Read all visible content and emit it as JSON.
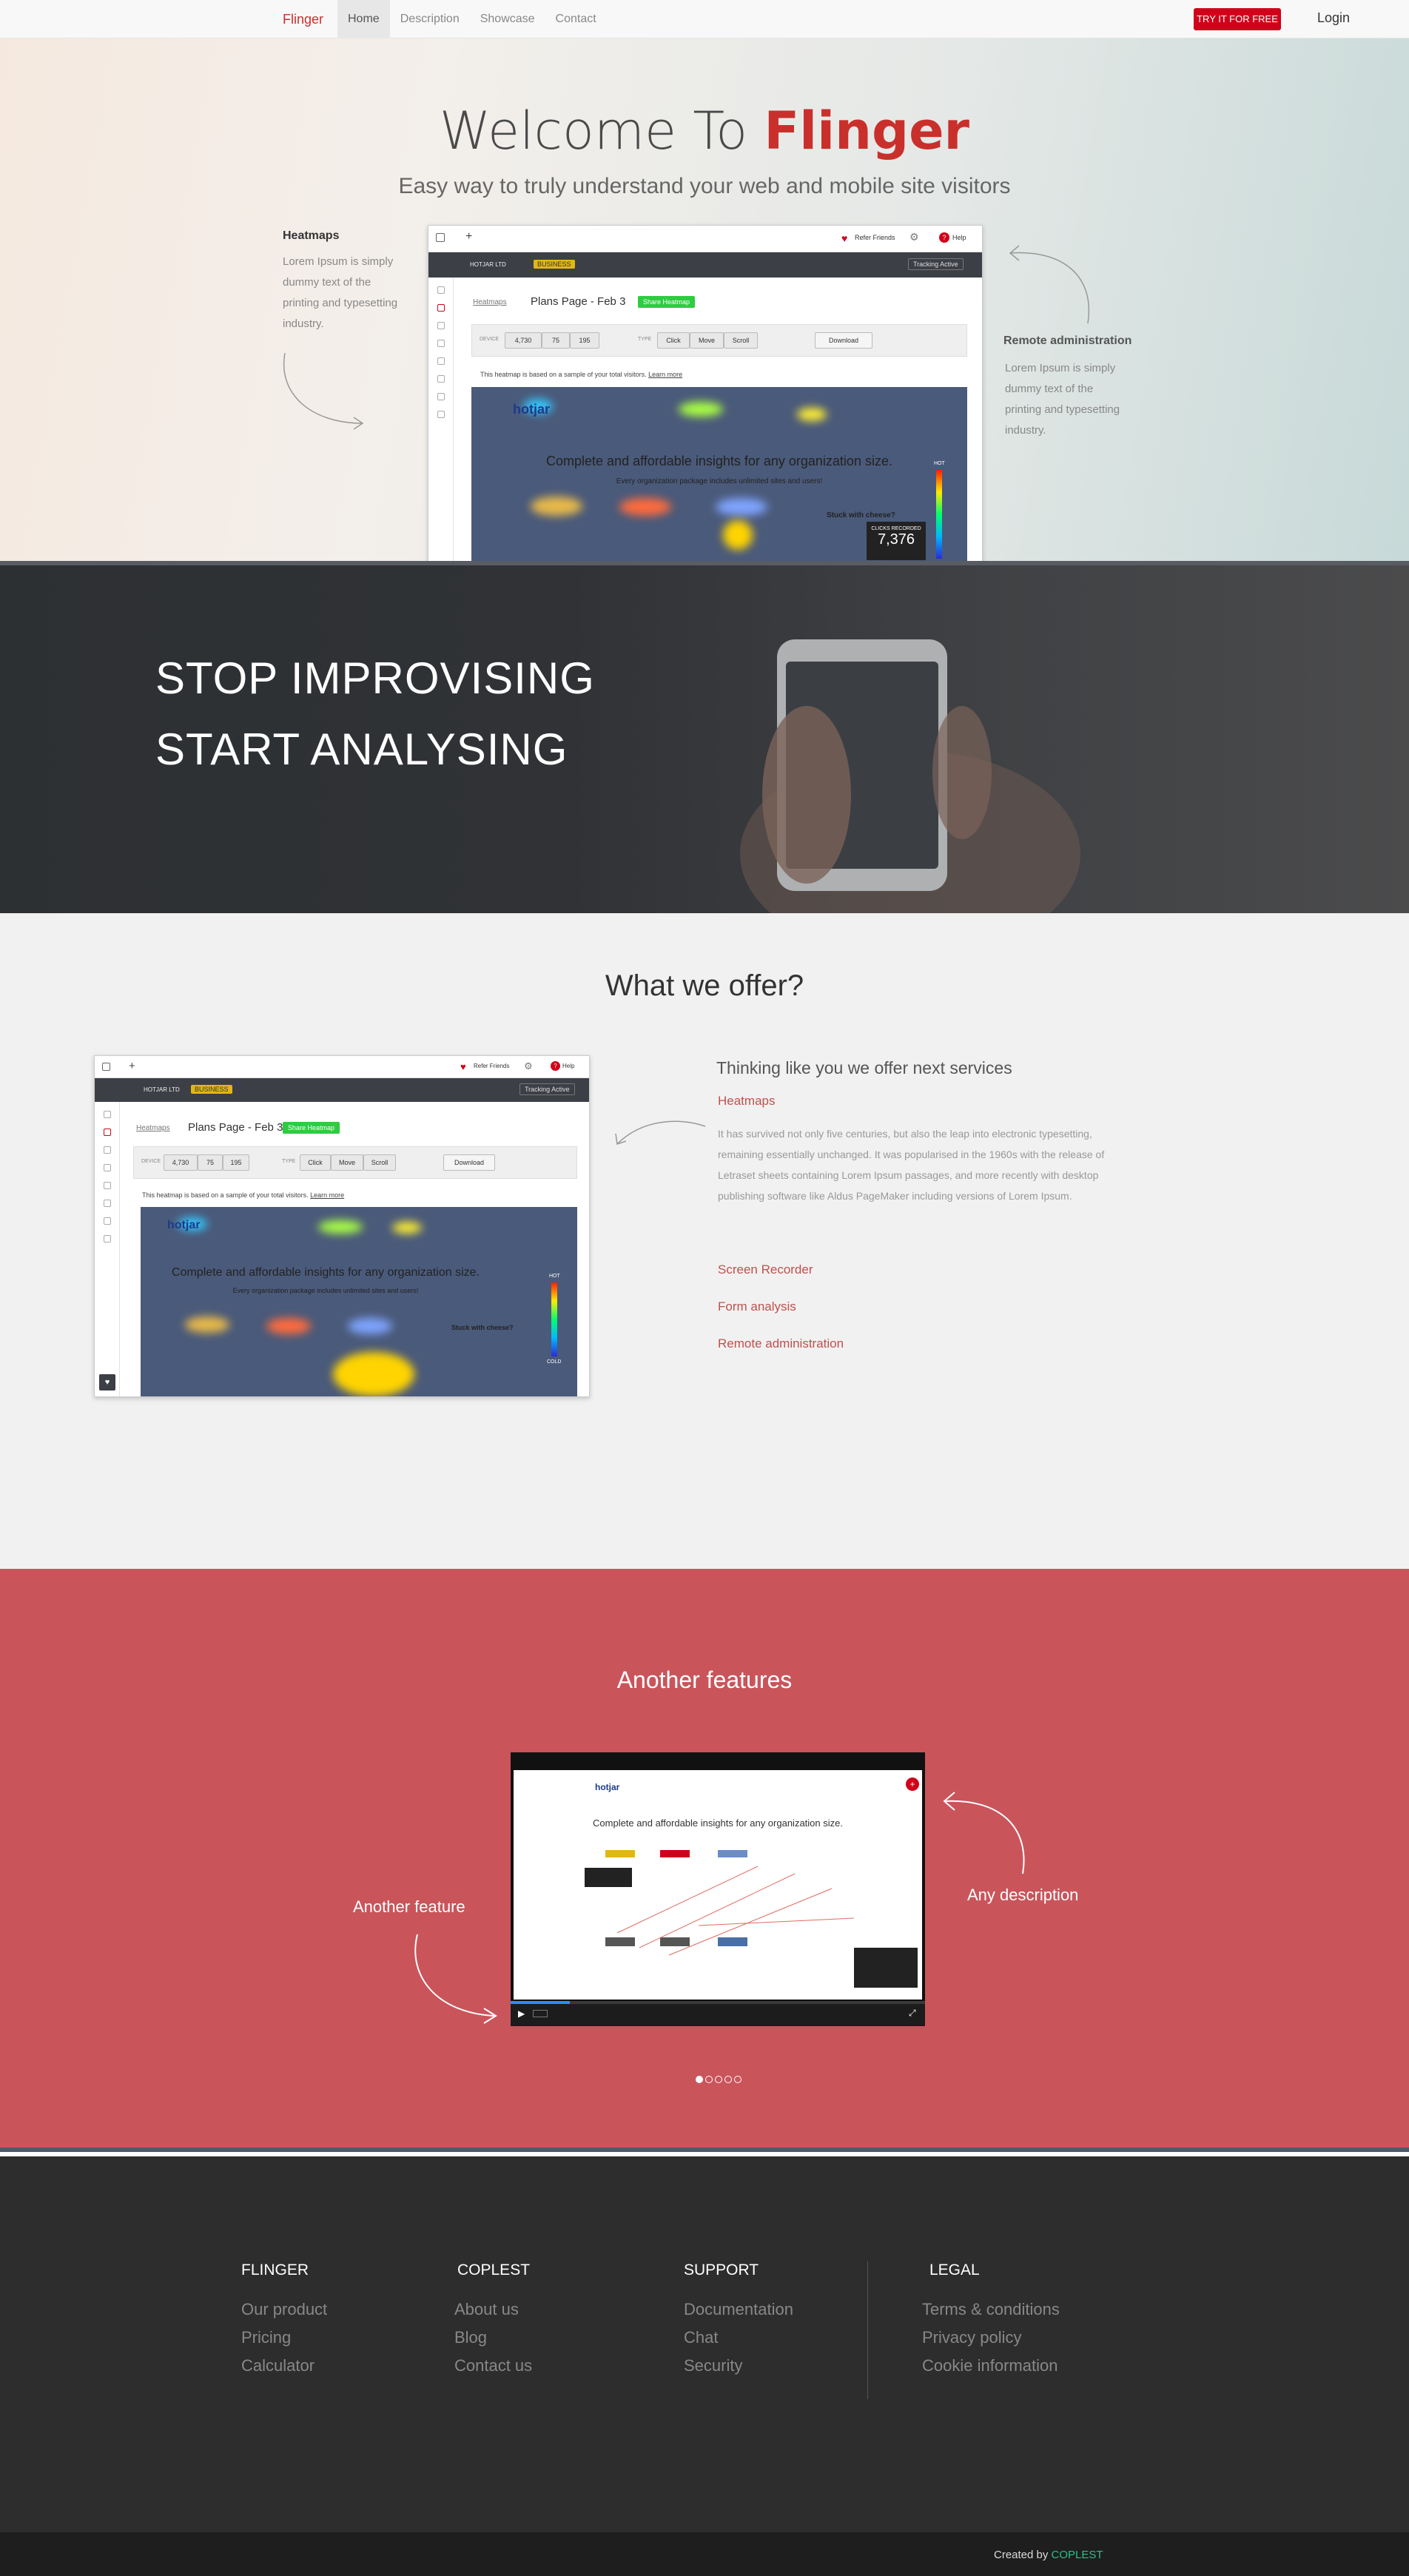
{
  "nav": {
    "brand": "Flinger",
    "links": [
      "Home",
      "Description",
      "Showcase",
      "Contact"
    ],
    "cta": "TRY IT FOR FREE",
    "login": "Login"
  },
  "hero": {
    "title_pre": "Welcome To",
    "title_highlight": "Flinger",
    "subtitle": "Easy way to truly understand your web and mobile site visitors",
    "left_title": "Heatmaps",
    "left_text": "Lorem Ipsum is simply dummy text of the printing and typesetting industry.",
    "right_title": "Remote administration",
    "right_text": "Lorem Ipsum is simply dummy text of the printing and typesetting industry."
  },
  "mock": {
    "friends": "Refer Friends",
    "help": "Help",
    "company": "HOTJAR LTD",
    "plan": "BUSINESS",
    "tracking": "Tracking Active",
    "crumb": "Heatmaps",
    "page": "Plans Page - Feb 3",
    "share": "Share Heatmap",
    "device_label": "DEVICE",
    "device_counts": [
      "4,730",
      "75",
      "195"
    ],
    "type_label": "TYPE",
    "types": [
      "Click",
      "Move",
      "Scroll"
    ],
    "download": "Download",
    "info": "This heatmap is based on a sample of your total visitors.",
    "learn_more": "Learn more",
    "heat_logo": "hotjar",
    "heat_heading": "Complete and affordable insights for any organization size.",
    "heat_sub": "Every organization package includes unlimited sites and users!",
    "heat_side": "Stuck with cheese?",
    "legend_hot": "HOT",
    "legend_cold": "COLD",
    "recorder": "CLICKS RECORDED",
    "recorder_value": "7,376"
  },
  "banner": {
    "line1": "STOP IMPROVISING",
    "line2": "START ANALYSING"
  },
  "offer": {
    "title": "What we offer?",
    "heading": "Thinking like you we offer next services",
    "items": [
      "Heatmaps",
      "Screen Recorder",
      "Form analysis",
      "Remote administration"
    ],
    "text": "It has survived not only five centuries, but also the leap into electronic typesetting, remaining essentially unchanged. It was popularised in the 1960s with the release of Letraset sheets containing Lorem Ipsum passages, and more recently with desktop publishing software like Aldus PageMaker including versions of Lorem Ipsum."
  },
  "features": {
    "title": "Another features",
    "left": "Another feature",
    "right": "Any description",
    "video_heading": "Complete and affordable insights for any organization size.",
    "video_logo": "hotjar",
    "slides": 5,
    "active_slide": 0
  },
  "footer": {
    "columns": [
      {
        "title": "FLINGER",
        "items": [
          "Our product",
          "Pricing",
          "Calculator"
        ]
      },
      {
        "title": "COPLEST",
        "items": [
          "About us",
          "Blog",
          "Contact us"
        ]
      },
      {
        "title": "SUPPORT",
        "items": [
          "Documentation",
          "Chat",
          "Security"
        ]
      },
      {
        "title": "LEGAL",
        "items": [
          "Terms & conditions",
          "Privacy policy",
          "Cookie information"
        ]
      }
    ],
    "created_by": "Created by",
    "created_link": "COPLEST"
  },
  "colors": {
    "accent": "#c9302c",
    "cta": "#d0021b",
    "features_bg": "#c9555b",
    "footer_bg": "#2d2d2d",
    "link_green": "#2fbf8a"
  }
}
